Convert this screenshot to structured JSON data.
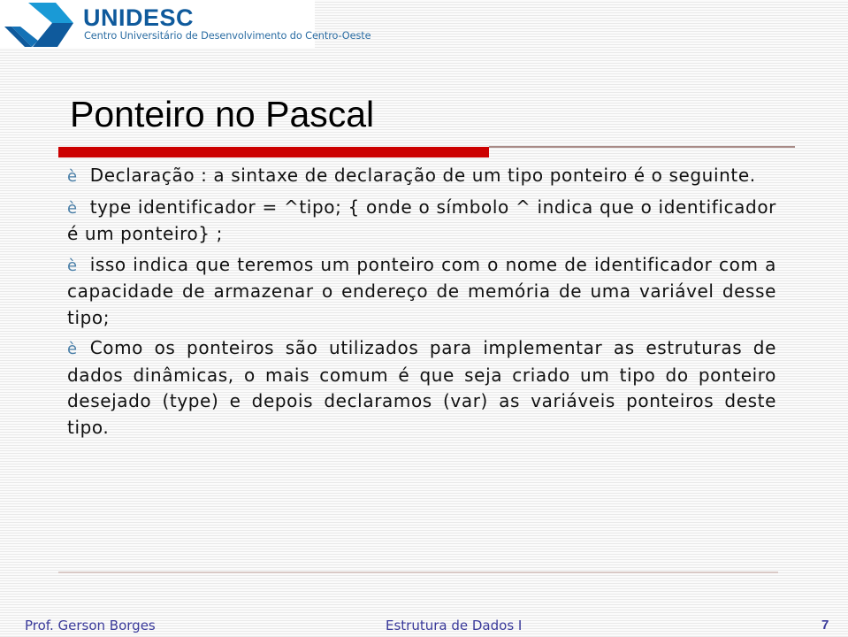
{
  "header": {
    "logo_name": "UNIDESC",
    "logo_subtitle": "Centro Universitário de Desenvolvimento do Centro-Oeste",
    "logo_icon": "unidesc-chevron-logo-icon"
  },
  "slide": {
    "title": "Ponteiro no Pascal",
    "bullet_glyph": "è",
    "accent_color": "#cc0000",
    "paragraphs": [
      "Declaração : a sintaxe de declaração de um tipo ponteiro é o seguinte.",
      "type identificador  =  ^tipo; { onde o símbolo ^  indica que o identificador é um ponteiro} ;",
      "isso indica que teremos um ponteiro com o nome de identificador com a capacidade de armazenar o endereço de memória de uma variável desse tipo;",
      "Como os ponteiros são utilizados para implementar as estruturas de dados dinâmicas, o mais comum é que seja criado um tipo do ponteiro desejado (type) e depois declaramos (var) as variáveis ponteiros deste tipo."
    ]
  },
  "footer": {
    "author": "Prof. Gerson Borges",
    "course": "Estrutura de Dados I",
    "page_number": "7",
    "text_color": "#3a3a9a"
  }
}
